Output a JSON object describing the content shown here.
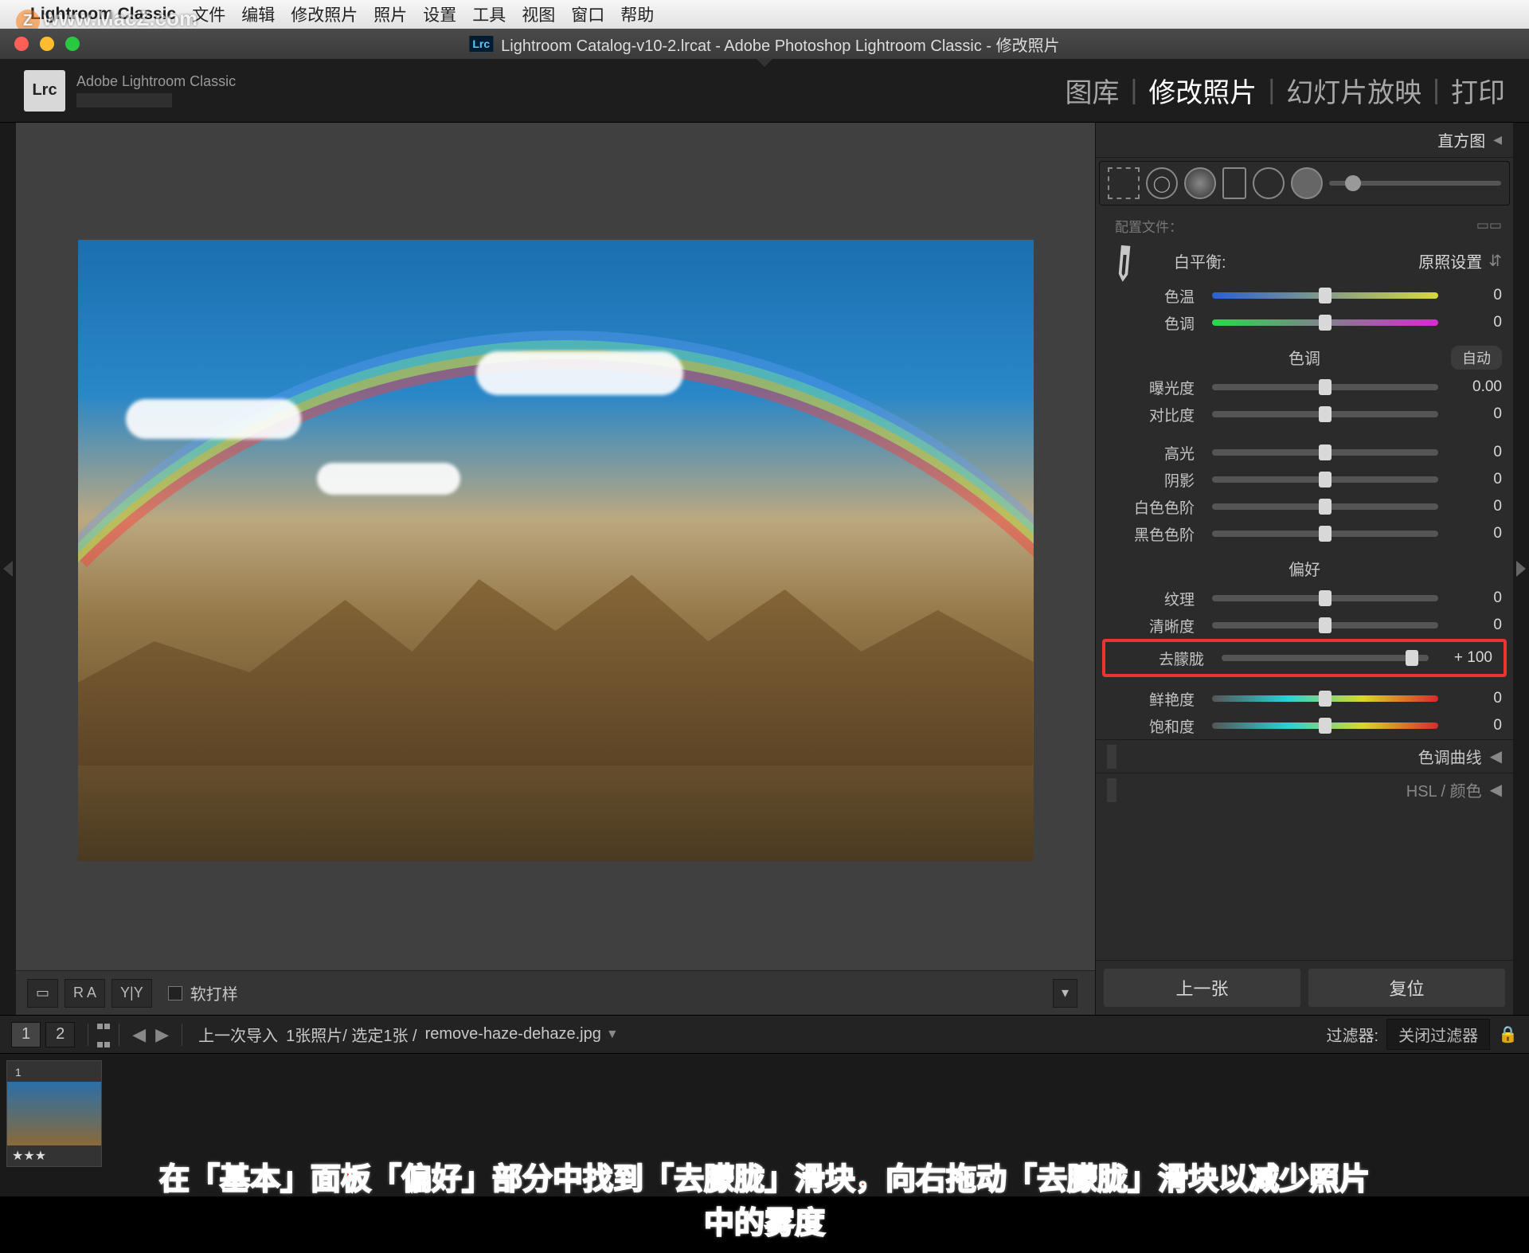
{
  "watermark": "www.MacZ.com",
  "menubar": {
    "apple": "",
    "app": "Lightroom Classic",
    "items": [
      "文件",
      "编辑",
      "修改照片",
      "照片",
      "设置",
      "工具",
      "视图",
      "窗口",
      "帮助"
    ]
  },
  "window": {
    "badge": "Lrc",
    "title": "Lightroom Catalog-v10-2.lrcat - Adobe Photoshop Lightroom Classic - 修改照片"
  },
  "identity": {
    "logo": "Lrc",
    "label": "Adobe Lightroom Classic"
  },
  "modules": {
    "items": [
      "图库",
      "修改照片",
      "幻灯片放映",
      "打印"
    ],
    "active_index": 1
  },
  "histogram_panel": "直方图",
  "toolstrip_config_label": "配置文件：",
  "wb": {
    "label": "白平衡:",
    "value": "原照设置"
  },
  "sliders": {
    "temp": {
      "label": "色温",
      "value": "0",
      "pos": 50,
      "cls": "s-temp"
    },
    "tint": {
      "label": "色调",
      "value": "0",
      "pos": 50,
      "cls": "s-tint"
    }
  },
  "tone": {
    "title": "色调",
    "auto": "自动",
    "items": [
      {
        "key": "exposure",
        "label": "曝光度",
        "value": "0.00",
        "pos": 50
      },
      {
        "key": "contrast",
        "label": "对比度",
        "value": "0",
        "pos": 50
      },
      {
        "key": "highlights",
        "label": "高光",
        "value": "0",
        "pos": 50
      },
      {
        "key": "shadows",
        "label": "阴影",
        "value": "0",
        "pos": 50
      },
      {
        "key": "whites",
        "label": "白色色阶",
        "value": "0",
        "pos": 50
      },
      {
        "key": "blacks",
        "label": "黑色色阶",
        "value": "0",
        "pos": 50
      }
    ]
  },
  "presence": {
    "title": "偏好",
    "items": [
      {
        "key": "texture",
        "label": "纹理",
        "value": "0",
        "pos": 50,
        "cls": "s-mid"
      },
      {
        "key": "clarity",
        "label": "清晰度",
        "value": "0",
        "pos": 50,
        "cls": "s-mid"
      }
    ],
    "dehaze": {
      "label": "去朦胧",
      "value": "+ 100",
      "pos": 92,
      "cls": "s-mid"
    },
    "items2": [
      {
        "key": "vibrance",
        "label": "鲜艳度",
        "value": "0",
        "pos": 50,
        "cls": "s-vib"
      },
      {
        "key": "saturation",
        "label": "饱和度",
        "value": "0",
        "pos": 50,
        "cls": "s-vib"
      }
    ]
  },
  "collapsed_panels": [
    "色调曲线",
    "HSL / 颜色"
  ],
  "nav": {
    "prev": "上一张",
    "reset": "复位"
  },
  "toolbar": {
    "loupe_icon": "▭",
    "ra": "R A",
    "yy": "Y|Y",
    "softproof": "软打样"
  },
  "filmstrip": {
    "view1": "1",
    "view2": "2",
    "breadcrumb_prefix": "上一次导入",
    "counts": "1张照片/ 选定1张 /",
    "filename": "remove-haze-dehaze.jpg",
    "filter_label": "过滤器:",
    "filter_value": "关闭过滤器"
  },
  "thumb": {
    "index": "1",
    "stars": "★★★"
  },
  "caption": {
    "line1": "在「基本」面板「偏好」部分中找到「去朦胧」滑块，向右拖动「去朦胧」滑块以减少照片",
    "line2": "中的雾度"
  }
}
